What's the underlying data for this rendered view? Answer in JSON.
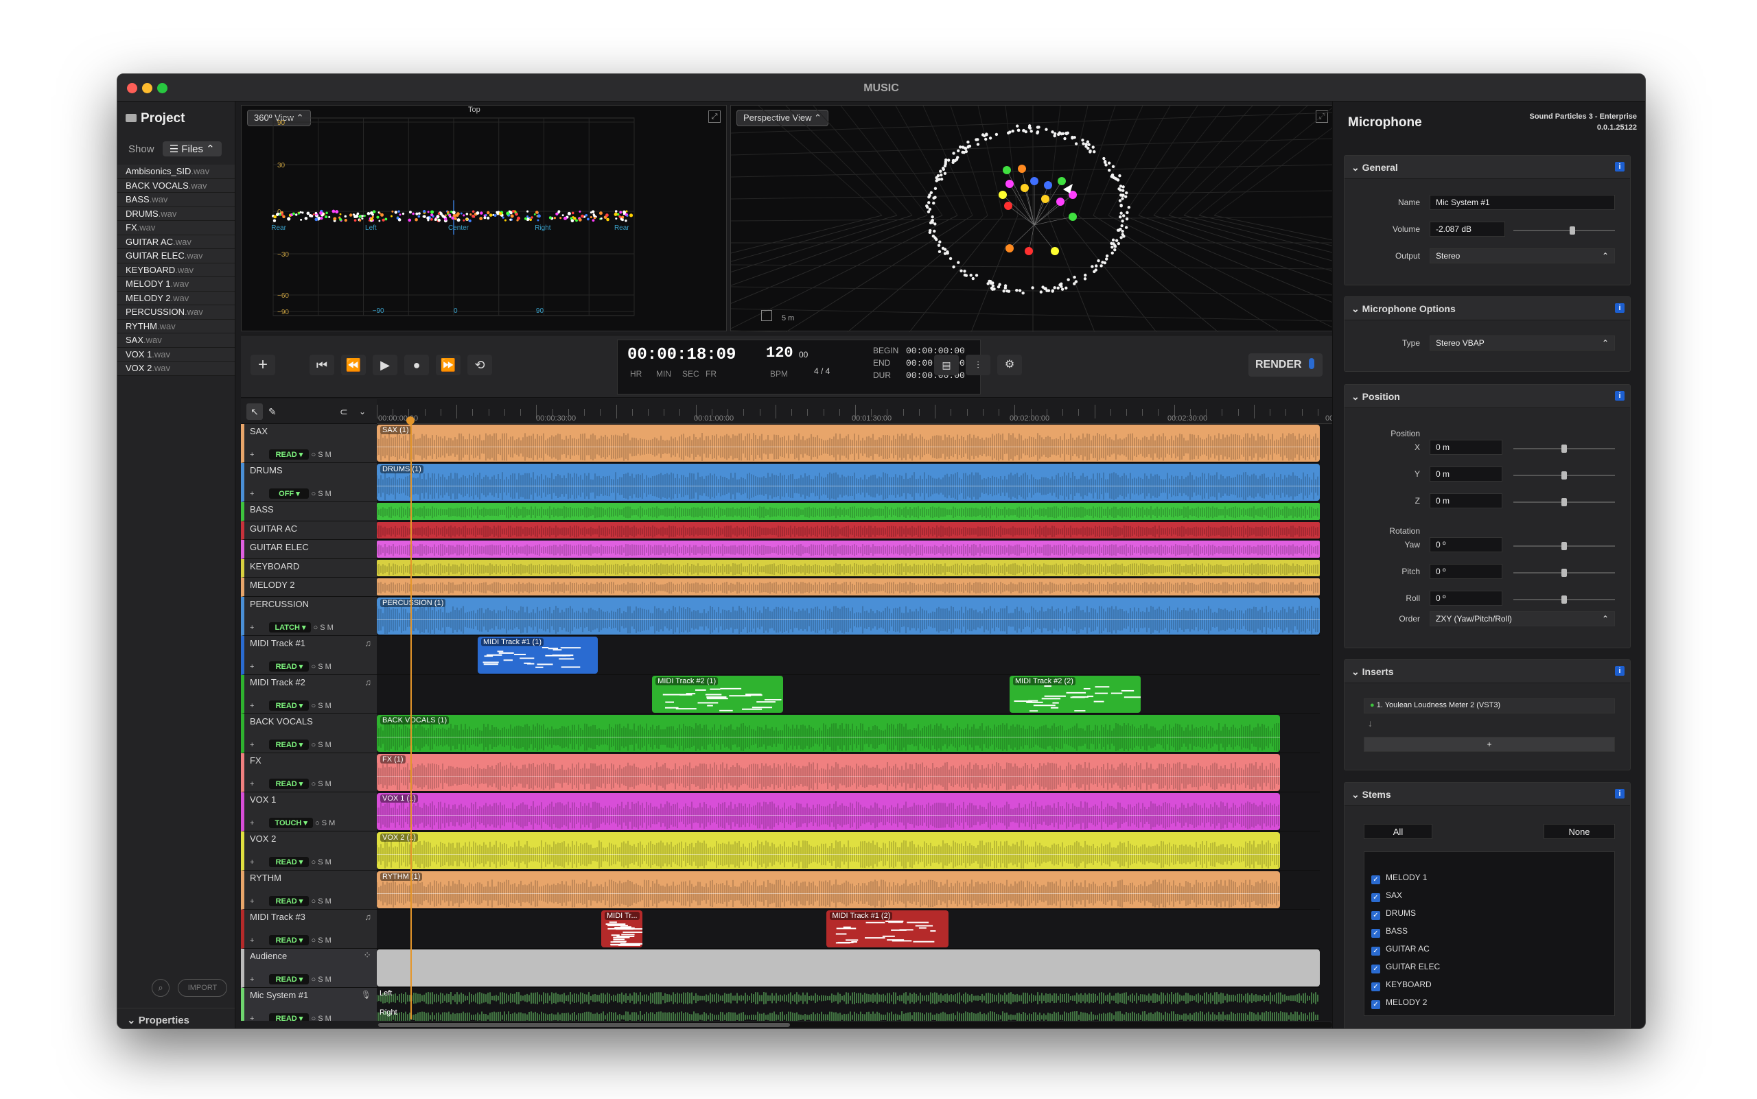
{
  "window": {
    "title": "MUSIC"
  },
  "project": {
    "title": "Project",
    "show_label": "Show",
    "show_value": "Files",
    "files": [
      {
        "name": "Ambisonics_SID",
        "ext": ".wav"
      },
      {
        "name": "BACK VOCALS",
        "ext": ".wav"
      },
      {
        "name": "BASS",
        "ext": ".wav"
      },
      {
        "name": "DRUMS",
        "ext": ".wav"
      },
      {
        "name": "FX",
        "ext": ".wav"
      },
      {
        "name": "GUITAR AC",
        "ext": ".wav"
      },
      {
        "name": "GUITAR ELEC",
        "ext": ".wav"
      },
      {
        "name": "KEYBOARD",
        "ext": ".wav"
      },
      {
        "name": "MELODY 1",
        "ext": ".wav"
      },
      {
        "name": "MELODY 2",
        "ext": ".wav"
      },
      {
        "name": "PERCUSSION",
        "ext": ".wav"
      },
      {
        "name": "RYTHM",
        "ext": ".wav"
      },
      {
        "name": "SAX",
        "ext": ".wav"
      },
      {
        "name": "VOX 1",
        "ext": ".wav"
      },
      {
        "name": "VOX 2",
        "ext": ".wav"
      }
    ],
    "import_label": "IMPORT",
    "properties_label": "Properties"
  },
  "view360": {
    "mode": "360º View",
    "top_label": "Top",
    "y_ticks": [
      "90",
      "30",
      "0",
      "−30",
      "−60",
      "−90"
    ],
    "x_ticks": [
      "−90",
      "0",
      "90"
    ],
    "dir_labels": [
      "Rear",
      "Left",
      "Center",
      "Right",
      "Rear"
    ]
  },
  "perspective": {
    "mode": "Perspective View",
    "scale_label": "5 m"
  },
  "transport": {
    "time": "00:00:18:09",
    "time_units": [
      "HR",
      "MIN",
      "SEC",
      "FR"
    ],
    "bpm": "120",
    "bpm_frac": "00",
    "bpm_label": "BPM",
    "signature": "4 / 4",
    "begin_label": "BEGIN",
    "begin": "00:00:00:00",
    "end_label": "END",
    "end": "00:00:00:00",
    "dur_label": "DUR",
    "dur": "00:00:00:00",
    "render_label": "RENDER"
  },
  "ruler": [
    "00:00:00:00",
    "00:00:30:00",
    "00:01:00:00",
    "00:01:30:00",
    "00:02:00:00",
    "00:02:30:00",
    "00:03"
  ],
  "tracks": [
    {
      "name": "SAX",
      "mode": "READ",
      "color": "#e8a56a",
      "clips": [
        {
          "label": "SAX (1)",
          "start": 0.0,
          "end": 1.0,
          "type": "audio"
        }
      ]
    },
    {
      "name": "DRUMS",
      "mode": "OFF",
      "color": "#4a8fd6",
      "clips": [
        {
          "label": "DRUMS (1)",
          "start": 0.0,
          "end": 1.0,
          "type": "audio"
        }
      ]
    },
    {
      "name": "BASS",
      "mode": "",
      "color": "#3ec43e",
      "clips": [
        {
          "label": "",
          "start": 0.0,
          "end": 1.0,
          "type": "thin"
        }
      ]
    },
    {
      "name": "GUITAR AC",
      "mode": "",
      "color": "#c8323c",
      "clips": [
        {
          "label": "",
          "start": 0.0,
          "end": 1.0,
          "type": "thin"
        }
      ]
    },
    {
      "name": "GUITAR ELEC",
      "mode": "",
      "color": "#e060e0",
      "clips": [
        {
          "label": "",
          "start": 0.0,
          "end": 1.0,
          "type": "thin"
        }
      ]
    },
    {
      "name": "KEYBOARD",
      "mode": "",
      "color": "#d8d040",
      "clips": [
        {
          "label": "",
          "start": 0.0,
          "end": 1.0,
          "type": "thin"
        }
      ]
    },
    {
      "name": "MELODY 2",
      "mode": "",
      "color": "#e8a56a",
      "clips": [
        {
          "label": "",
          "start": 0.0,
          "end": 1.0,
          "type": "thin"
        }
      ]
    },
    {
      "name": "PERCUSSION",
      "mode": "LATCH",
      "color": "#4a8fd6",
      "clips": [
        {
          "label": "PERCUSSION (1)",
          "start": 0.0,
          "end": 1.0,
          "type": "audio"
        }
      ]
    },
    {
      "name": "MIDI Track #1",
      "mode": "READ",
      "color": "#2a6bd1",
      "clips": [
        {
          "label": "MIDI Track #1 (1)",
          "start": 0.107,
          "end": 0.234,
          "type": "midi"
        }
      ]
    },
    {
      "name": "MIDI Track #2",
      "mode": "READ",
      "color": "#2fb32f",
      "clips": [
        {
          "label": "MIDI Track #2 (1)",
          "start": 0.292,
          "end": 0.431,
          "type": "midi"
        },
        {
          "label": "MIDI Track #2 (2)",
          "start": 0.671,
          "end": 0.81,
          "type": "midi"
        }
      ]
    },
    {
      "name": "BACK VOCALS",
      "mode": "READ",
      "color": "#2fb32f",
      "clips": [
        {
          "label": "BACK VOCALS (1)",
          "start": 0.0,
          "end": 0.958,
          "type": "audio"
        }
      ]
    },
    {
      "name": "FX",
      "mode": "READ",
      "color": "#f08080",
      "clips": [
        {
          "label": "FX (1)",
          "start": 0.0,
          "end": 0.958,
          "type": "audio"
        }
      ]
    },
    {
      "name": "VOX 1",
      "mode": "TOUCH",
      "color": "#d84ed8",
      "clips": [
        {
          "label": "VOX 1 (1)",
          "start": 0.0,
          "end": 0.958,
          "type": "audio"
        }
      ]
    },
    {
      "name": "VOX 2",
      "mode": "READ",
      "color": "#e0e040",
      "clips": [
        {
          "label": "VOX 2 (1)",
          "start": 0.0,
          "end": 0.958,
          "type": "audio"
        }
      ]
    },
    {
      "name": "RYTHM",
      "mode": "READ",
      "color": "#e8a56a",
      "clips": [
        {
          "label": "RYTHM (1)",
          "start": 0.0,
          "end": 0.958,
          "type": "audio"
        }
      ]
    },
    {
      "name": "MIDI Track #3",
      "mode": "READ",
      "color": "#b52a2a",
      "clips": [
        {
          "label": "MIDI Tr...",
          "start": 0.238,
          "end": 0.282,
          "type": "midi"
        },
        {
          "label": "MIDI Track #1 (2)",
          "start": 0.477,
          "end": 0.606,
          "type": "midi"
        }
      ]
    },
    {
      "name": "Audience",
      "mode": "READ",
      "color": "#bbbbbb",
      "clips": [
        {
          "label": "",
          "start": 0.0,
          "end": 1.0,
          "type": "gray"
        }
      ]
    },
    {
      "name": "Mic System #1",
      "mode": "READ",
      "color": "#6fd66f",
      "clips": [
        {
          "label": "",
          "start": 0.0,
          "end": 1.0,
          "type": "mic"
        }
      ],
      "channels": [
        "Left",
        "Right"
      ]
    }
  ],
  "microphone": {
    "title": "Microphone",
    "product": "Sound Particles 3 - Enterprise",
    "version": "0.0.1.25122",
    "general": {
      "title": "General",
      "name_label": "Name",
      "name": "Mic System #1",
      "volume_label": "Volume",
      "volume": "-2.087 dB",
      "output_label": "Output",
      "output": "Stereo"
    },
    "options": {
      "title": "Microphone Options",
      "type_label": "Type",
      "type": "Stereo VBAP"
    },
    "position": {
      "title": "Position",
      "position_label": "Position",
      "x_label": "X",
      "x": "0 m",
      "y_label": "Y",
      "y": "0 m",
      "z_label": "Z",
      "z": "0 m",
      "rotation_label": "Rotation",
      "yaw_label": "Yaw",
      "yaw": "0 º",
      "pitch_label": "Pitch",
      "pitch": "0 º",
      "roll_label": "Roll",
      "roll": "0 º",
      "order_label": "Order",
      "order": "ZXY (Yaw/Pitch/Roll)"
    },
    "inserts": {
      "title": "Inserts",
      "item": "1. Youlean Loudness Meter 2 (VST3)",
      "add": "+"
    },
    "stems": {
      "title": "Stems",
      "all": "All",
      "none": "None",
      "items": [
        "MELODY 1",
        "SAX",
        "DRUMS",
        "BASS",
        "GUITAR AC",
        "GUITAR ELEC",
        "KEYBOARD",
        "MELODY 2"
      ]
    }
  }
}
